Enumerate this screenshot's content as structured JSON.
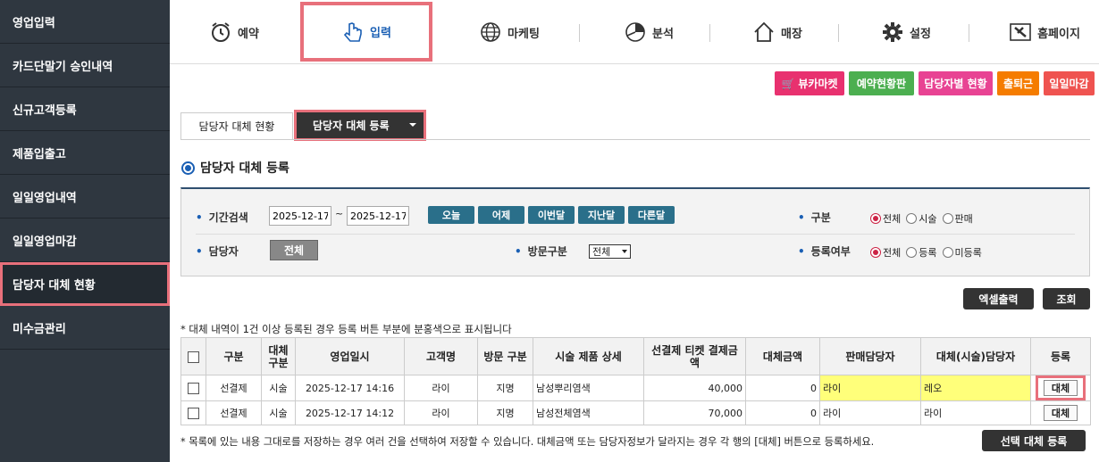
{
  "sidebar": {
    "items": [
      {
        "label": "영업입력",
        "active": false
      },
      {
        "label": "카드단말기 승인내역",
        "active": false
      },
      {
        "label": "신규고객등록",
        "active": false
      },
      {
        "label": "제품입출고",
        "active": false
      },
      {
        "label": "일일영업내역",
        "active": false
      },
      {
        "label": "일일영업마감",
        "active": false
      },
      {
        "label": "담당자 대체 현황",
        "active": true
      },
      {
        "label": "미수금관리",
        "active": false
      }
    ]
  },
  "topnav": {
    "items": [
      {
        "label": "예약",
        "icon": "alarm-clock-icon"
      },
      {
        "label": "입력",
        "icon": "pointer-hand-icon",
        "active": true
      },
      {
        "label": "마케팅",
        "icon": "globe-icon"
      },
      {
        "label": "분석",
        "icon": "pie-chart-icon"
      },
      {
        "label": "매장",
        "icon": "house-icon"
      },
      {
        "label": "설정",
        "icon": "gear-icon"
      },
      {
        "label": "홈페이지",
        "icon": "tools-icon"
      }
    ]
  },
  "top_buttons": {
    "beauty_market": "뷰카마켓",
    "reservation_board": "예약현황판",
    "staff_status": "담당자별 현황",
    "attendance": "출퇴근",
    "daily_close": "일일마감",
    "colors": {
      "beauty_market": "#e8316f",
      "reservation_board": "#4caf50",
      "staff_status": "#e84393",
      "attendance": "#f57c00",
      "daily_close": "#ef5350"
    }
  },
  "tabs": {
    "status": "담당자 대체 현황",
    "register": "담당자 대체 등록"
  },
  "section_title": "담당자 대체 등록",
  "search": {
    "period_label": "기간검색",
    "date_from": "2025-12-17",
    "date_sep": "~",
    "date_to": "2025-12-17",
    "quick": [
      "오늘",
      "어제",
      "이번달",
      "지난달",
      "다른달"
    ],
    "category_label": "구분",
    "category_options": [
      {
        "label": "전체",
        "checked": true
      },
      {
        "label": "시술",
        "checked": false
      },
      {
        "label": "판매",
        "checked": false
      }
    ],
    "staff_label": "담당자",
    "staff_value": "전체",
    "visit_label": "방문구분",
    "visit_value": "전체",
    "reg_label": "등록여부",
    "reg_options": [
      {
        "label": "전체",
        "checked": true
      },
      {
        "label": "등록",
        "checked": false
      },
      {
        "label": "미등록",
        "checked": false
      }
    ]
  },
  "actions": {
    "excel": "엑셀출력",
    "search": "조회"
  },
  "note_top": "* 대체 내역이 1건 이상 등록된 경우 등록 버튼 부분에 분홍색으로 표시됩니다",
  "table": {
    "headers": {
      "category": "구분",
      "replace_type": "대체 구분",
      "sale_datetime": "영업일시",
      "customer": "고객명",
      "visit_type": "방문 구분",
      "service_detail": "시술 제품 상세",
      "prepaid_amount": "선결제 티켓 결제금액",
      "replace_amount": "대체금액",
      "sales_staff": "판매담당자",
      "replace_staff": "대체(시술)담당자",
      "register": "등록"
    },
    "rows": [
      {
        "category": "선결제",
        "replace_type": "시술",
        "sale_datetime": "2025-12-17 14:16",
        "customer": "라이",
        "visit_type": "지명",
        "service_detail": "남성뿌리염색",
        "prepaid_amount": "40,000",
        "replace_amount": "0",
        "sales_staff": "라이",
        "replace_staff": "레오",
        "register": "대체",
        "highlight": true
      },
      {
        "category": "선결제",
        "replace_type": "시술",
        "sale_datetime": "2025-12-17 14:12",
        "customer": "라이",
        "visit_type": "지명",
        "service_detail": "남성전체염색",
        "prepaid_amount": "70,000",
        "replace_amount": "0",
        "sales_staff": "라이",
        "replace_staff": "라이",
        "register": "대체",
        "highlight": false
      }
    ]
  },
  "note_bottom": "* 목록에 있는 내용 그대로를 저장하는 경우 여러 건을 선택하여 저장할 수 있습니다. 대체금액 또는 담당자정보가 달라지는 경우 각 행의 [대체] 버튼으로 등록하세요.",
  "bulk_register": "선택 대체 등록"
}
